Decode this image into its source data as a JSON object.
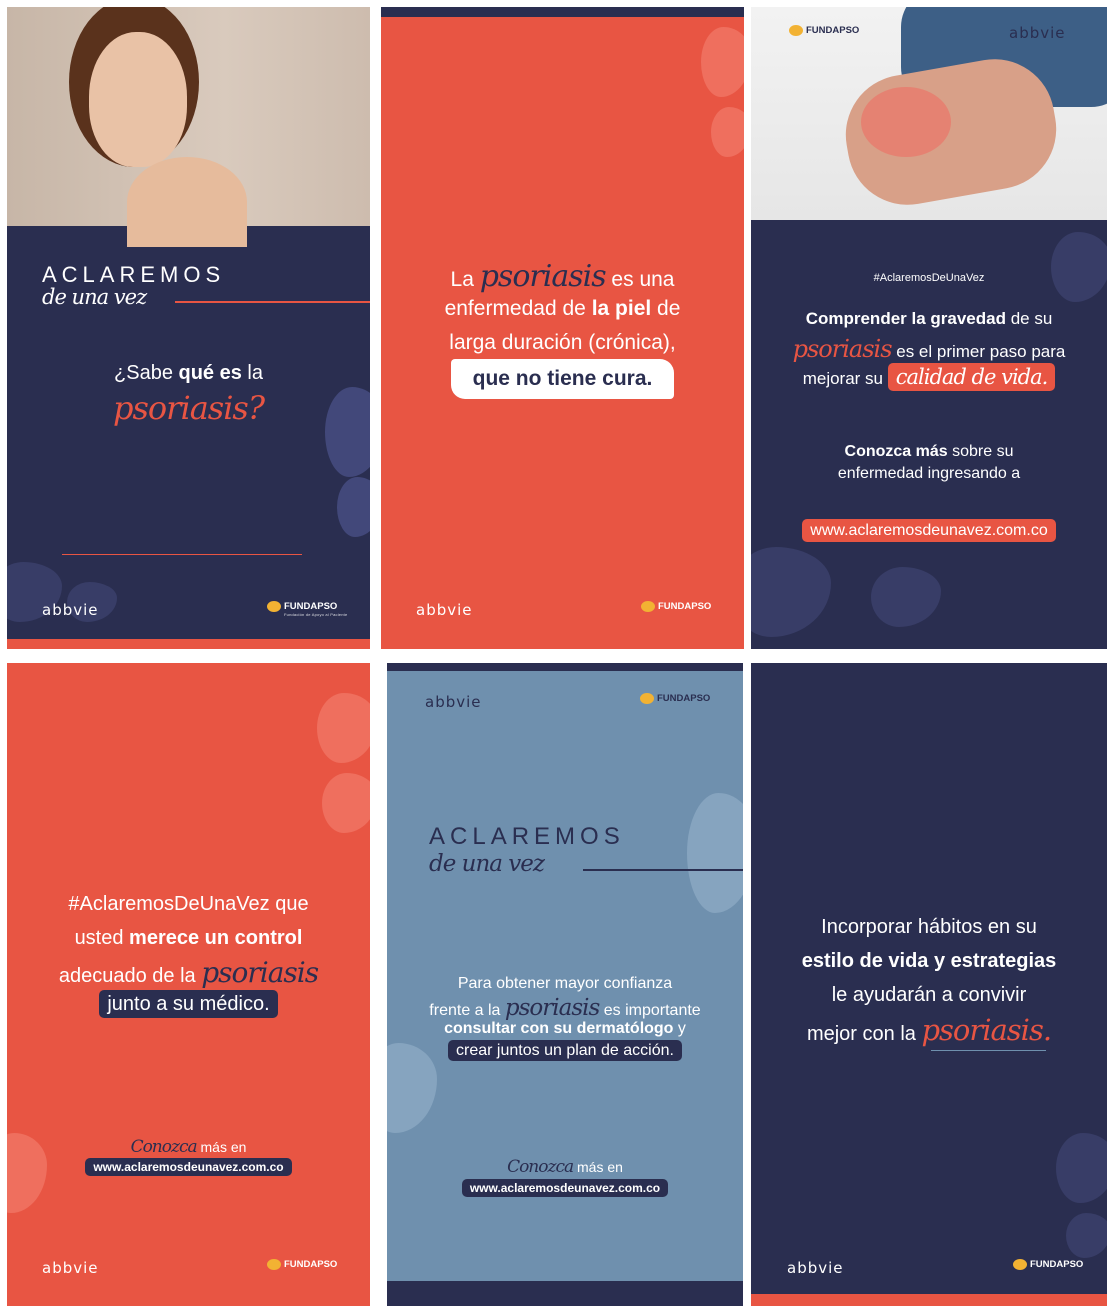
{
  "brands": {
    "abbvie": "abbvie",
    "fundapso": "FUNDAPSO",
    "fundapso_sub": "Fundación de Apoyo al Paciente con Psoriasis y otras Enfermedades de la Piel"
  },
  "colors": {
    "navy": "#2a2e50",
    "coral": "#e85543",
    "steel": "#6f90ae",
    "white": "#ffffff"
  },
  "panel1": {
    "title": "ACLAREMOS",
    "subtitle": "de una vez",
    "q_prefix": "¿Sabe ",
    "q_bold": "qué es",
    "q_suffix": " la",
    "script_word": "psoriasis?",
    "photo_icon": "smiling-woman-photo"
  },
  "panel2": {
    "l1_pre": "La ",
    "l1_script": "psoriasis",
    "l1_post": " es una",
    "l2_pre": "enfermedad de ",
    "l2_bold": "la piel",
    "l2_post": " de",
    "l3": "larga duración (crónica),",
    "l4": "que no tiene cura."
  },
  "panel3": {
    "hashtag": "#AclaremosDeUnaVez",
    "l1_bold": "Comprender la gravedad",
    "l1_post": " de su",
    "l2_script": "psoriasis",
    "l2_post": " es el primer paso para",
    "l3_pre": "mejorar su ",
    "l3_script": "calidad de vida.",
    "l4_bold": "Conozca más",
    "l4_post": " sobre su",
    "l5": "enfermedad ingresando a",
    "url": "www.aclaremosdeunavez.com.co",
    "photo_icon": "scratching-arm-photo"
  },
  "panel4": {
    "l1_pre": "#AclaremosDeUnaVez",
    "l1_post": " que",
    "l2_pre": "usted ",
    "l2_bold": "merece un control",
    "l3_pre": "adecuado de la ",
    "l3_script": "psoriasis",
    "l4": "junto a su médico.",
    "more_script": "Conozca",
    "more_post": " más en",
    "url": "www.aclaremosdeunavez.com.co"
  },
  "panel5": {
    "title": "ACLAREMOS",
    "subtitle": "de una vez",
    "l1": "Para obtener mayor confianza",
    "l2_pre": "frente a la ",
    "l2_script": "psoriasis",
    "l2_post": " es importante",
    "l3_bold": "consultar con su dermatólogo",
    "l3_post": " y",
    "l4": "crear juntos un plan de acción.",
    "more_script": "Conozca",
    "more_post": " más en",
    "url": "www.aclaremosdeunavez.com.co"
  },
  "panel6": {
    "l1": "Incorporar hábitos en su",
    "l2_bold": "estilo de vida y estrategias",
    "l3": "le ayudarán a convivir",
    "l4_pre": "mejor con la ",
    "l4_script": "psoriasis."
  }
}
